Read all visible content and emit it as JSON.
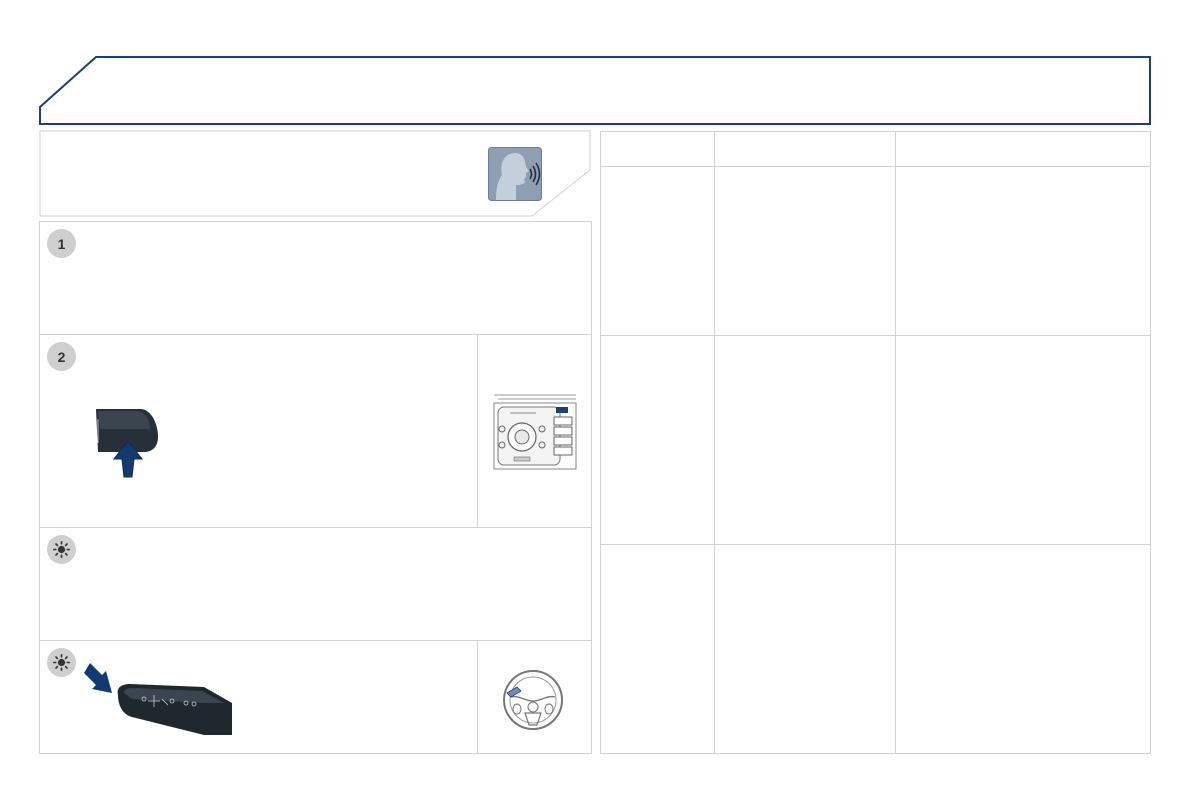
{
  "header": {
    "title": ""
  },
  "sections": {
    "voice_panel": {
      "icon": "voice-command-icon"
    },
    "step_1": {
      "number": "1"
    },
    "step_2": {
      "number": "2"
    },
    "tip_1": {
      "icon": "lamp-tip-icon"
    },
    "tip_2": {
      "icon": "lamp-tip-icon"
    }
  },
  "table": {
    "header": [
      "",
      "",
      ""
    ],
    "rows": [
      [
        "",
        "",
        ""
      ],
      [
        "",
        "",
        ""
      ],
      [
        "",
        "",
        ""
      ]
    ]
  },
  "colors": {
    "header_border": "#1d3f72",
    "arrow": "#123a6e",
    "badge": "#cfcfcf",
    "voice_icon_bg": "#8e9fb3",
    "grid": "#d2d2d2"
  }
}
